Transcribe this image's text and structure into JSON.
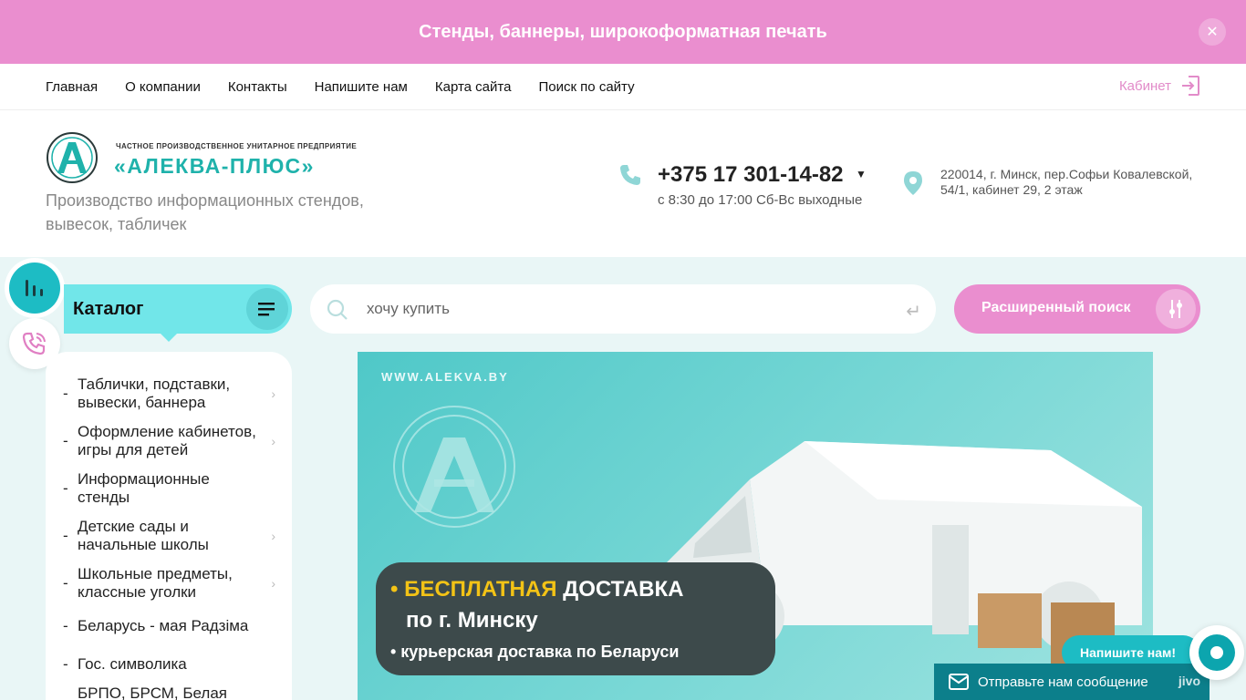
{
  "promo": {
    "text": "Стенды, баннеры, широкоформатная печать",
    "close": "✕"
  },
  "nav": {
    "links": [
      "Главная",
      "О компании",
      "Контакты",
      "Напишите нам",
      "Карта сайта",
      "Поиск по сайту"
    ],
    "cabinet": "Кабинет"
  },
  "header": {
    "logo_small": "ЧАСТНОЕ ПРОИЗВОДСТВЕННОЕ УНИТАРНОЕ ПРЕДПРИЯТИЕ",
    "logo_big": "«АЛЕКВА-ПЛЮС»",
    "tagline": "Производство информационных стендов, вывесок, табличек",
    "phone": "+375 17 301-14-82",
    "hours": "с 8:30 до 17:00 Сб-Вс выходные",
    "address": "220014, г. Минск, пер.Софьи Ковалевской, 54/1, кабинет 29, 2 этаж"
  },
  "catalog": {
    "title": "Каталог",
    "items": [
      {
        "label": "Таблички, подставки, вывески, баннера",
        "has_children": true
      },
      {
        "label": "Оформление кабинетов, игры для детей",
        "has_children": true
      },
      {
        "label": "Информационные стенды",
        "has_children": false
      },
      {
        "label": "Детские сады и начальные школы",
        "has_children": true
      },
      {
        "label": "Школьные предметы, классные уголки",
        "has_children": true
      },
      {
        "label": "Беларусь - мая Радзіма",
        "has_children": false
      },
      {
        "label": "Гос. символика",
        "has_children": false
      },
      {
        "label": "БРПО, БРСМ, Белая Русь",
        "has_children": false
      }
    ]
  },
  "search": {
    "placeholder": "хочу купить",
    "advanced_label": "Расширенный поиск"
  },
  "banner": {
    "url": "WWW.ALEKVA.BY",
    "line1_highlight": "БЕСПЛАТНАЯ",
    "line1_rest": "ДОСТАВКА",
    "line2": "по г. Минску",
    "line3": "• курьерская доставка по Беларуси"
  },
  "chat": {
    "bubble": "Напишите нам!",
    "bar_text": "Отправьте нам сообщение",
    "brand": "jivo"
  },
  "colors": {
    "accent_pink": "#ea8ecf",
    "accent_teal": "#1dbcc4",
    "catalog_bg": "#71e6e9",
    "page_bg": "#e9f6f6"
  }
}
